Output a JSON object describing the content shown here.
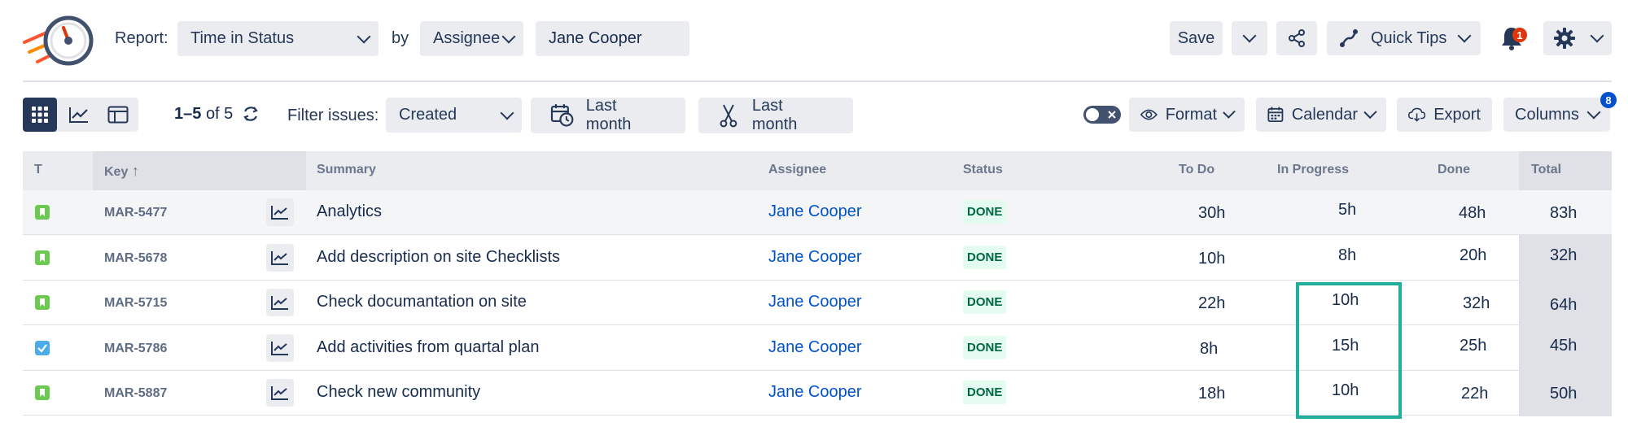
{
  "header": {
    "report_label": "Report:",
    "report_value": "Time in Status",
    "by_label": "by",
    "by_value": "Assignee",
    "user_value": "Jane Cooper",
    "save_label": "Save",
    "quick_tips_label": "Quick Tips",
    "notification_count": "1"
  },
  "toolbar": {
    "pagination": "1–5",
    "pagination_of": "of 5",
    "filter_label": "Filter issues:",
    "filter_value": "Created",
    "date_range_1": "Last month",
    "date_range_2": "Last month",
    "format_label": "Format",
    "calendar_label": "Calendar",
    "export_label": "Export",
    "columns_label": "Columns",
    "columns_badge": "8"
  },
  "table": {
    "headers": {
      "type": "T",
      "key": "Key",
      "summary": "Summary",
      "assignee": "Assignee",
      "status": "Status",
      "todo": "To Do",
      "in_progress": "In Progress",
      "done": "Done",
      "total": "Total"
    },
    "rows": [
      {
        "type": "story",
        "key": "MAR-5477",
        "summary": "Analytics",
        "assignee": "Jane Cooper",
        "status": "DONE",
        "todo": "30h",
        "in_progress": "5h",
        "done": "48h",
        "total": "83h"
      },
      {
        "type": "story",
        "key": "MAR-5678",
        "summary": "Add description on site Checklists",
        "assignee": "Jane Cooper",
        "status": "DONE",
        "todo": "10h",
        "in_progress": "8h",
        "done": "20h",
        "total": "32h"
      },
      {
        "type": "story",
        "key": "MAR-5715",
        "summary": "Check documantation on site",
        "assignee": "Jane Cooper",
        "status": "DONE",
        "todo": "22h",
        "in_progress": "10h",
        "done": "32h",
        "total": "64h"
      },
      {
        "type": "task",
        "key": "MAR-5786",
        "summary": "Add activities from quartal plan",
        "assignee": "Jane Cooper",
        "status": "DONE",
        "todo": "8h",
        "in_progress": "15h",
        "done": "25h",
        "total": "45h"
      },
      {
        "type": "story",
        "key": "MAR-5887",
        "summary": "Check new community",
        "assignee": "Jane Cooper",
        "status": "DONE",
        "todo": "18h",
        "in_progress": "10h",
        "done": "22h",
        "total": "50h"
      }
    ]
  },
  "colors": {
    "accent": "#1fae9c",
    "link": "#0052cc",
    "story": "#6bc950",
    "task": "#4bade8",
    "badge_red": "#de350b"
  }
}
